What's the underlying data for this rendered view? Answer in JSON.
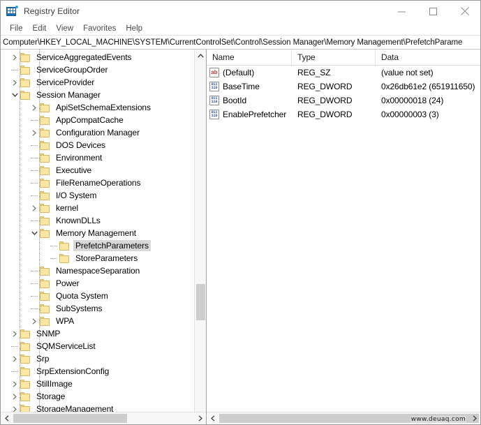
{
  "window": {
    "title": "Registry Editor",
    "icon": "registry-editor-icon",
    "controls": {
      "minimize": "minimize-icon",
      "maximize": "maximize-icon",
      "close": "close-icon"
    }
  },
  "menubar": {
    "items": [
      {
        "label": "File"
      },
      {
        "label": "Edit"
      },
      {
        "label": "View"
      },
      {
        "label": "Favorites"
      },
      {
        "label": "Help"
      }
    ]
  },
  "address": {
    "path": "Computer\\HKEY_LOCAL_MACHINE\\SYSTEM\\CurrentControlSet\\Control\\Session Manager\\Memory Management\\PrefetchParame"
  },
  "tree": {
    "rows": [
      {
        "label": "ServiceAggregatedEvents",
        "depth": 1,
        "twisty": "collapsed",
        "selected": false
      },
      {
        "label": "ServiceGroupOrder",
        "depth": 1,
        "twisty": "none",
        "selected": false
      },
      {
        "label": "ServiceProvider",
        "depth": 1,
        "twisty": "collapsed",
        "selected": false
      },
      {
        "label": "Session Manager",
        "depth": 1,
        "twisty": "expanded",
        "selected": false
      },
      {
        "label": "ApiSetSchemaExtensions",
        "depth": 2,
        "twisty": "collapsed",
        "selected": false
      },
      {
        "label": "AppCompatCache",
        "depth": 2,
        "twisty": "none",
        "selected": false
      },
      {
        "label": "Configuration Manager",
        "depth": 2,
        "twisty": "collapsed",
        "selected": false
      },
      {
        "label": "DOS Devices",
        "depth": 2,
        "twisty": "none",
        "selected": false
      },
      {
        "label": "Environment",
        "depth": 2,
        "twisty": "none",
        "selected": false
      },
      {
        "label": "Executive",
        "depth": 2,
        "twisty": "none",
        "selected": false
      },
      {
        "label": "FileRenameOperations",
        "depth": 2,
        "twisty": "none",
        "selected": false
      },
      {
        "label": "I/O System",
        "depth": 2,
        "twisty": "none",
        "selected": false
      },
      {
        "label": "kernel",
        "depth": 2,
        "twisty": "collapsed",
        "selected": false
      },
      {
        "label": "KnownDLLs",
        "depth": 2,
        "twisty": "none",
        "selected": false
      },
      {
        "label": "Memory Management",
        "depth": 2,
        "twisty": "expanded",
        "selected": false
      },
      {
        "label": "PrefetchParameters",
        "depth": 3,
        "twisty": "none",
        "selected": true
      },
      {
        "label": "StoreParameters",
        "depth": 3,
        "twisty": "none",
        "selected": false
      },
      {
        "label": "NamespaceSeparation",
        "depth": 2,
        "twisty": "none",
        "selected": false
      },
      {
        "label": "Power",
        "depth": 2,
        "twisty": "none",
        "selected": false
      },
      {
        "label": "Quota System",
        "depth": 2,
        "twisty": "none",
        "selected": false
      },
      {
        "label": "SubSystems",
        "depth": 2,
        "twisty": "none",
        "selected": false
      },
      {
        "label": "WPA",
        "depth": 2,
        "twisty": "collapsed",
        "selected": false
      },
      {
        "label": "SNMP",
        "depth": 1,
        "twisty": "collapsed",
        "selected": false
      },
      {
        "label": "SQMServiceList",
        "depth": 1,
        "twisty": "none",
        "selected": false
      },
      {
        "label": "Srp",
        "depth": 1,
        "twisty": "collapsed",
        "selected": false
      },
      {
        "label": "SrpExtensionConfig",
        "depth": 1,
        "twisty": "none",
        "selected": false
      },
      {
        "label": "StillImage",
        "depth": 1,
        "twisty": "collapsed",
        "selected": false
      },
      {
        "label": "Storage",
        "depth": 1,
        "twisty": "collapsed",
        "selected": false
      },
      {
        "label": "StorageManagement",
        "depth": 1,
        "twisty": "collapsed",
        "selected": false
      }
    ]
  },
  "list": {
    "columns": [
      {
        "label": "Name"
      },
      {
        "label": "Type"
      },
      {
        "label": "Data"
      }
    ],
    "rows": [
      {
        "icon": "string-value-icon",
        "name": "(Default)",
        "type": "REG_SZ",
        "data": "(value not set)"
      },
      {
        "icon": "dword-value-icon",
        "name": "BaseTime",
        "type": "REG_DWORD",
        "data": "0x26db61e2 (651911650)"
      },
      {
        "icon": "dword-value-icon",
        "name": "BootId",
        "type": "REG_DWORD",
        "data": "0x00000018 (24)"
      },
      {
        "icon": "dword-value-icon",
        "name": "EnablePrefetcher",
        "type": "REG_DWORD",
        "data": "0x00000003 (3)"
      }
    ]
  },
  "watermark": {
    "text": "www.deuaq.com"
  }
}
